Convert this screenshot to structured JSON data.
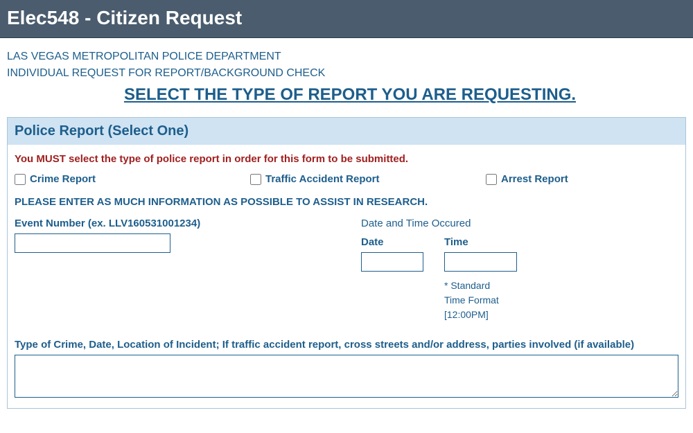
{
  "header": {
    "title": "Elec548 - Citizen Request"
  },
  "org": {
    "department": "LAS VEGAS METROPOLITAN POLICE DEPARTMENT",
    "form_name": "INDIVIDUAL REQUEST FOR REPORT/BACKGROUND CHECK"
  },
  "prompt": {
    "select_type": "SELECT THE TYPE OF REPORT YOU ARE REQUESTING."
  },
  "section": {
    "police_report_header": "Police Report (Select One)",
    "must_select_warning": "You MUST select the type of police report in order for this form to be submitted.",
    "options": {
      "crime": "Crime Report",
      "traffic": "Traffic Accident Report",
      "arrest": "Arrest Report"
    },
    "enter_info": "PLEASE ENTER AS MUCH INFORMATION AS POSSIBLE TO ASSIST IN RESEARCH."
  },
  "fields": {
    "event_number_label": "Event Number (ex. LLV160531001234)",
    "event_number_value": "",
    "datetime_heading": "Date and Time Occured",
    "date_label": "Date",
    "date_value": "",
    "time_label": "Time",
    "time_value": "",
    "time_note_1": "* Standard",
    "time_note_2": "Time Format",
    "time_note_3": "[12:00PM]",
    "details_label": "Type of Crime, Date, Location of Incident; If traffic accident report, cross streets and/or address, parties involved (if available)",
    "details_value": ""
  }
}
